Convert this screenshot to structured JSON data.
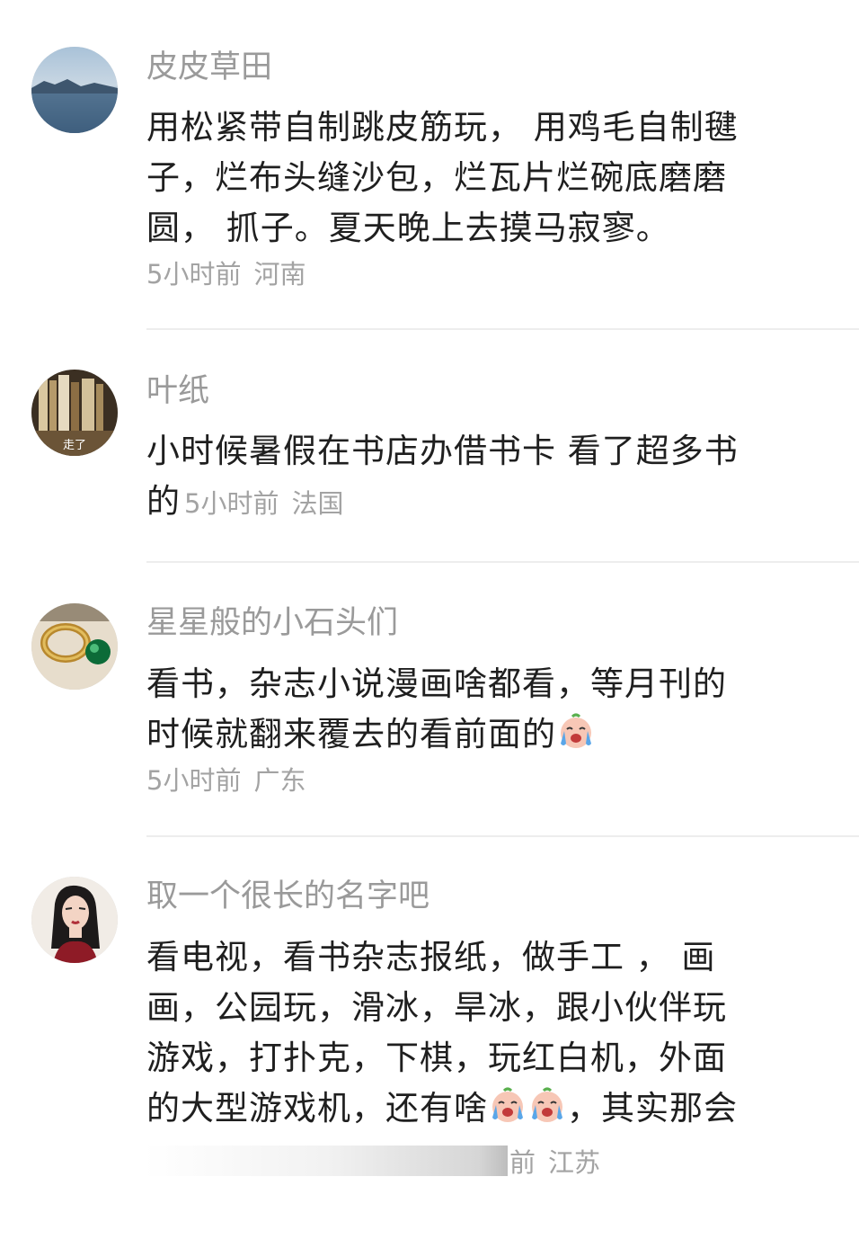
{
  "comments": [
    {
      "username": "皮皮草田",
      "lines": [
        "用松紧带自制跳皮筋玩， 用鸡毛自制毽",
        "子，烂布头缝沙包，烂瓦片烂碗底磨磨",
        "圆， 抓子。夏天晚上去摸马寂寥。"
      ],
      "time": "5小时前",
      "location": "河南",
      "avatar_icon": "lake-landscape-avatar"
    },
    {
      "username": "叶纸",
      "lines": [
        "小时候暑假在书店办借书卡 看了超多书",
        "的"
      ],
      "time": "5小时前",
      "location": "法国",
      "avatar_icon": "bookshelf-avatar",
      "avatar_text": "走了"
    },
    {
      "username": "星星般的小石头们",
      "lines": [
        "看书，杂志小说漫画啥都看，等月刊的",
        "时候就翻来覆去的看前面的"
      ],
      "time": "5小时前",
      "location": "广东",
      "avatar_icon": "ring-gem-avatar",
      "emoji": "crying-face-emoji"
    },
    {
      "username": "取一个很长的名字吧",
      "lines": [
        "看电视，看书杂志报纸，做手工 ， 画",
        "画，公园玩，滑冰，旱冰，跟小伙伴玩",
        "游戏，打扑克，下棋，玩红白机，外面",
        "的大型游戏机，还有啥",
        "，其实那会"
      ],
      "time_partial": "前",
      "location": "江苏",
      "avatar_icon": "woman-portrait-avatar",
      "emoji": "crying-face-emoji"
    }
  ],
  "colors": {
    "username": "#9a9a9a",
    "text": "#1f1f1f",
    "meta": "#a3a3a3",
    "divider": "#ededed"
  }
}
